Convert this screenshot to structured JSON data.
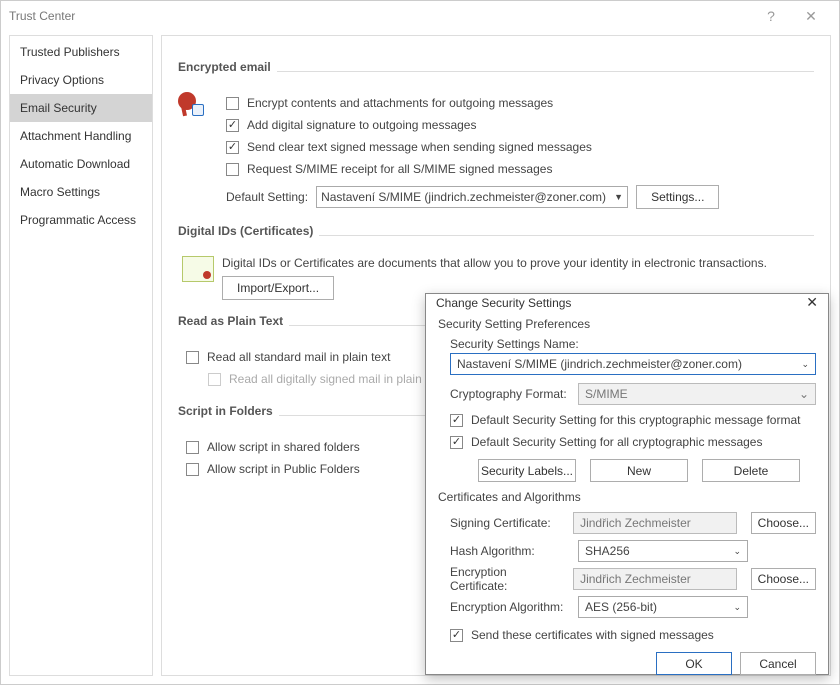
{
  "window": {
    "title": "Trust Center"
  },
  "nav": [
    "Trusted Publishers",
    "Privacy Options",
    "Email Security",
    "Attachment Handling",
    "Automatic Download",
    "Macro Settings",
    "Programmatic Access"
  ],
  "nav_selected_index": 2,
  "encrypted_email": {
    "title": "Encrypted email",
    "opts": [
      {
        "label": "Encrypt contents and attachments for outgoing messages",
        "checked": false,
        "u": "E"
      },
      {
        "label": "Add digital signature to outgoing messages",
        "checked": true,
        "u": "d"
      },
      {
        "label": "Send clear text signed message when sending signed messages",
        "checked": true,
        "u": "t"
      },
      {
        "label": "Request S/MIME receipt for all S/MIME signed messages",
        "checked": false,
        "u": "R"
      }
    ],
    "default_label": "Default Setting:",
    "default_value": "Nastavení S/MIME (jindrich.zechmeister@zoner.com)",
    "settings_btn": "Settings..."
  },
  "digital_ids": {
    "title": "Digital IDs (Certificates)",
    "desc": "Digital IDs or Certificates are documents that allow you to prove your identity in electronic transactions.",
    "import_btn": "Import/Export..."
  },
  "plain_text": {
    "title": "Read as Plain Text",
    "opts": [
      {
        "label": "Read all standard mail in plain text",
        "checked": false,
        "u": "a"
      },
      {
        "label": "Read all digitally signed mail in plain text",
        "checked": false,
        "disabled": true,
        "u": "m"
      }
    ]
  },
  "script_folders": {
    "title": "Script in Folders",
    "opts": [
      {
        "label": "Allow script in shared folders",
        "checked": false,
        "u": "f"
      },
      {
        "label": "Allow script in Public Folders",
        "checked": false,
        "u": "F"
      }
    ]
  },
  "dialog": {
    "title": "Change Security Settings",
    "pref_title": "Security Setting Preferences",
    "name_label": "Security Settings Name:",
    "name_value": "Nastavení S/MIME (jindrich.zechmeister@zoner.com)",
    "crypto_label": "Cryptography Format:",
    "crypto_value": "S/MIME",
    "chk1": "Default Security Setting for this cryptographic message format",
    "chk2": "Default Security Setting for all cryptographic messages",
    "btns": [
      "Security Labels...",
      "New",
      "Delete"
    ],
    "cert_title": "Certificates and Algorithms",
    "rows": [
      {
        "label": "Signing Certificate:",
        "value": "Jindřich Zechmeister",
        "type": "gray",
        "choose": true
      },
      {
        "label": "Hash Algorithm:",
        "value": "SHA256",
        "type": "combo",
        "choose": false
      },
      {
        "label": "Encryption Certificate:",
        "value": "Jindřich Zechmeister",
        "type": "gray",
        "choose": true
      },
      {
        "label": "Encryption Algorithm:",
        "value": "AES (256-bit)",
        "type": "combo",
        "choose": false
      }
    ],
    "choose": "Choose...",
    "send_chk": "Send these certificates with signed messages",
    "ok": "OK",
    "cancel": "Cancel"
  }
}
